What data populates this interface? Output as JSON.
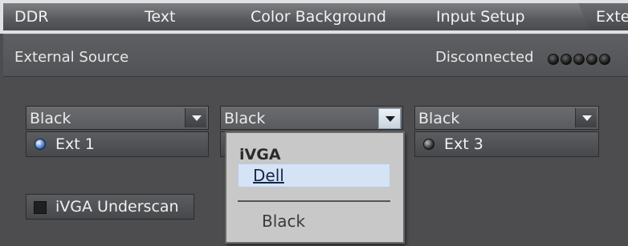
{
  "tabs": [
    {
      "label": "DDR"
    },
    {
      "label": "Text"
    },
    {
      "label": "Color Background"
    },
    {
      "label": "Input Setup"
    },
    {
      "label": "Exte"
    }
  ],
  "section": {
    "title": "External Source",
    "status": "Disconnected",
    "indicator_count": 5
  },
  "combos": [
    {
      "value": "Black"
    },
    {
      "value": "Black"
    },
    {
      "value": "Black"
    }
  ],
  "externals": [
    {
      "label": "Ext 1",
      "selected": true
    },
    {
      "label": "Ext 3",
      "selected": false
    }
  ],
  "underscan": {
    "label": "iVGA Underscan",
    "checked": false
  },
  "dropdown": {
    "group_label": "iVGA",
    "highlighted": "Dell",
    "other": "Black"
  },
  "colors": {
    "selection_highlight": "#d5e3f5",
    "panel": "#4d4d50"
  }
}
